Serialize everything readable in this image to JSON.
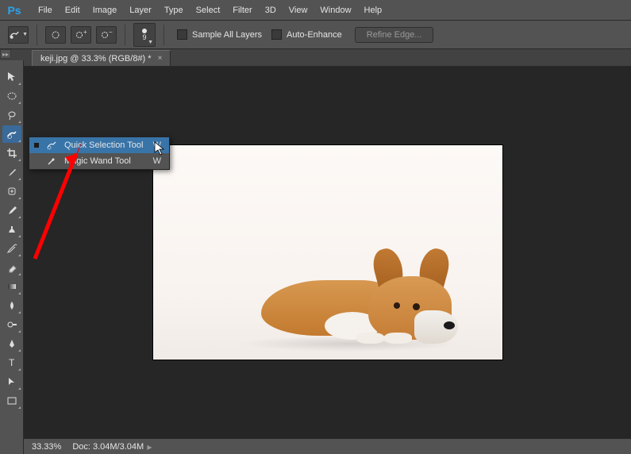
{
  "menu": [
    "File",
    "Edit",
    "Image",
    "Layer",
    "Type",
    "Select",
    "Filter",
    "3D",
    "View",
    "Window",
    "Help"
  ],
  "options": {
    "brush_size": "9",
    "sample_all": "Sample All Layers",
    "auto_enhance": "Auto-Enhance",
    "refine": "Refine Edge..."
  },
  "tab": {
    "title": "keji.jpg @ 33.3% (RGB/8#) *"
  },
  "flyout": {
    "items": [
      {
        "label": "Quick Selection Tool",
        "key": "W",
        "selected": true
      },
      {
        "label": "Magic Wand Tool",
        "key": "W",
        "selected": false
      }
    ]
  },
  "status": {
    "zoom": "33.33%",
    "doc": "Doc: 3.04M/3.04M"
  }
}
